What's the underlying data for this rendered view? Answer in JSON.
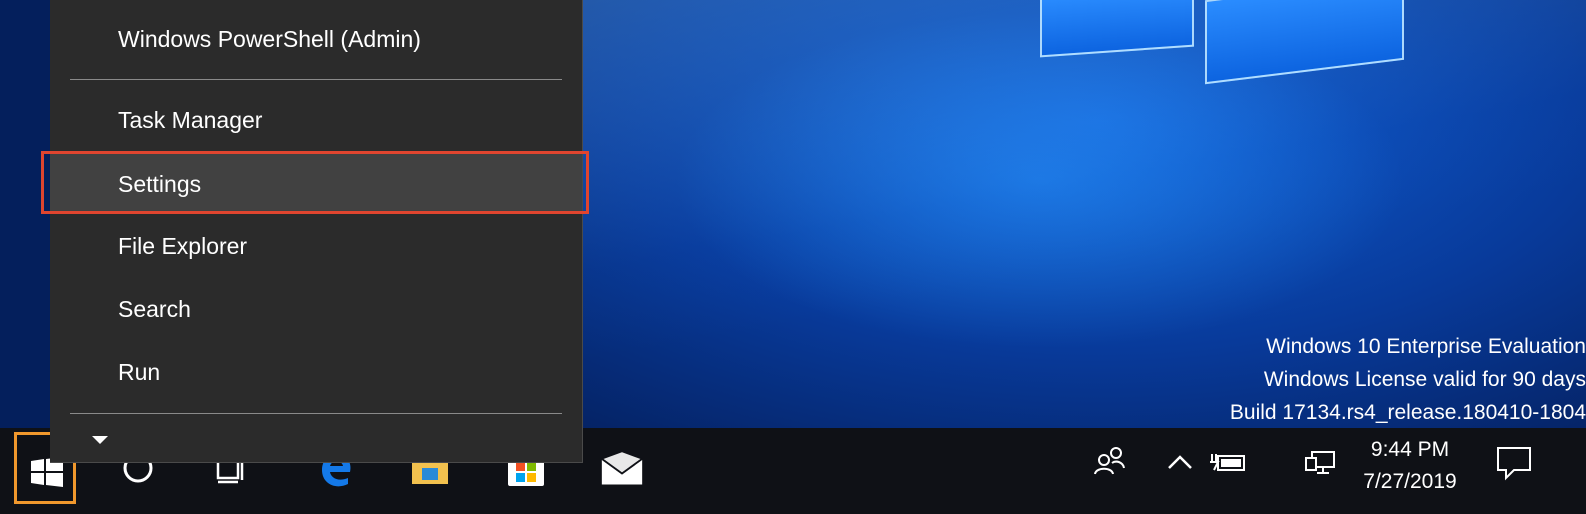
{
  "context_menu": {
    "items": [
      {
        "label": "Windows PowerShell (Admin)"
      },
      {
        "label": "Task Manager"
      },
      {
        "label": "Settings"
      },
      {
        "label": "File Explorer"
      },
      {
        "label": "Search"
      },
      {
        "label": "Run"
      }
    ]
  },
  "watermark": {
    "line1": "Windows 10 Enterprise Evaluation",
    "line2": "Windows License valid for 90 days",
    "line3": "Build 17134.rs4_release.180410-1804"
  },
  "clock": {
    "time": "9:44 PM",
    "date": "7/27/2019"
  },
  "taskbar": {
    "icons": [
      "windows-logo-icon",
      "cortana-icon",
      "task-view-icon",
      "edge-icon",
      "file-explorer-icon",
      "store-icon",
      "mail-icon"
    ],
    "tray_icons": [
      "people-icon",
      "chevron-up-icon",
      "battery-icon",
      "network-icon",
      "action-center-icon"
    ]
  },
  "colors": {
    "menu_bg": "#2b2b2b",
    "menu_hover": "#414141",
    "highlight_box": "#e0452f",
    "start_highlight": "#f0982d",
    "taskbar_bg": "#0f1116"
  }
}
